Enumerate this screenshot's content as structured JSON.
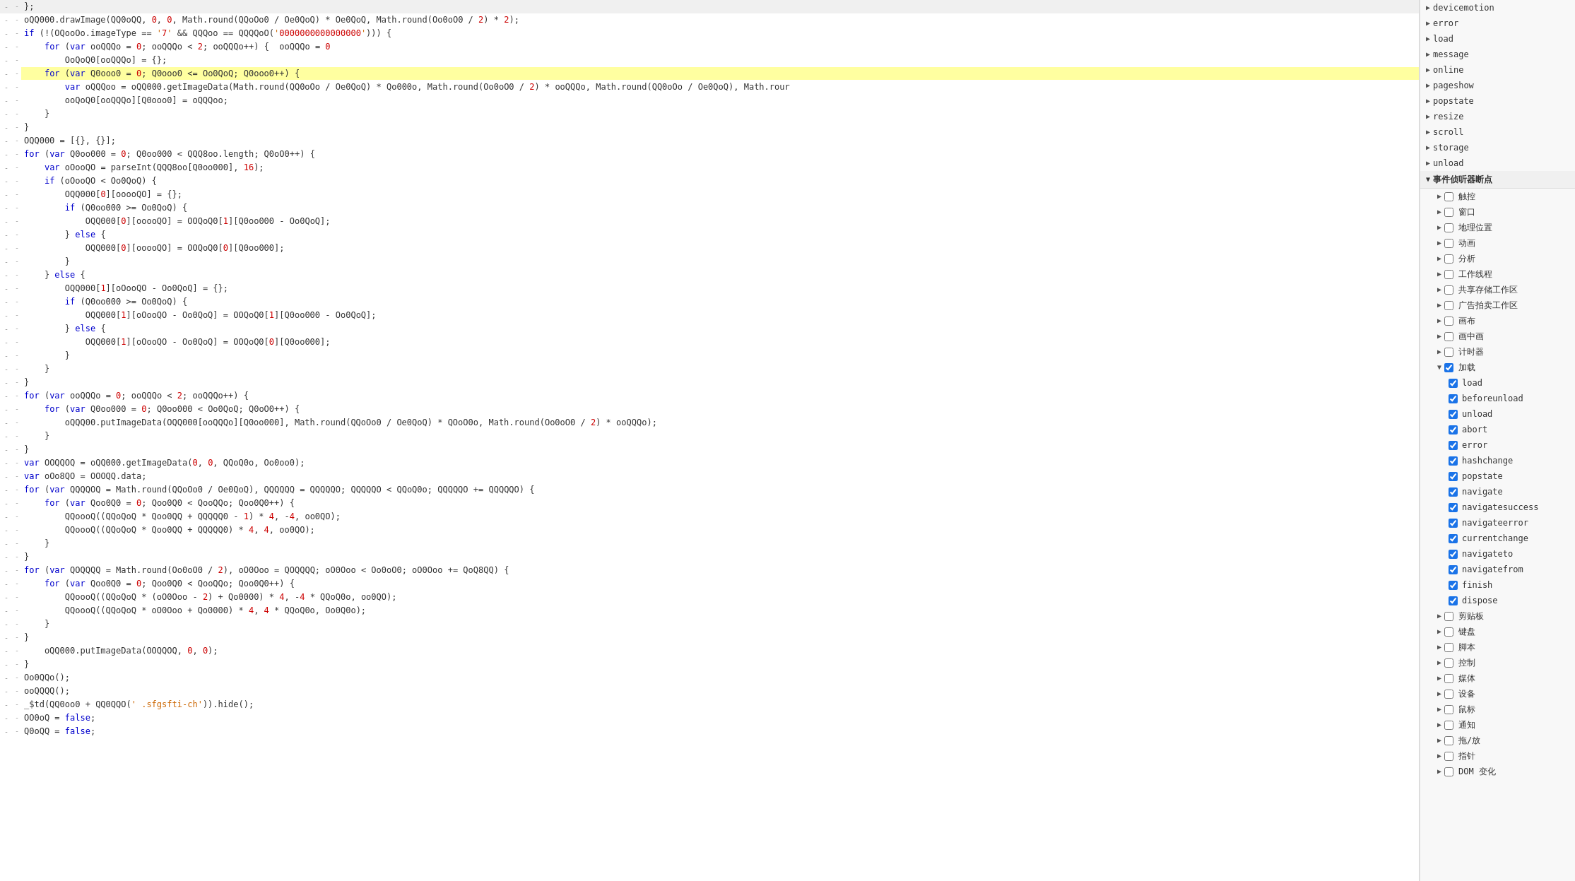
{
  "code_lines": [
    {
      "gutter": "-",
      "dash": "-",
      "content": "};",
      "highlight": false
    },
    {
      "gutter": "-",
      "dash": "-",
      "content": "oQQ000.drawImage(QQ0oQQ, 0, 0, Math.round(QQoOo0 / Oe0QoQ) * Oe0QoQ, Math.round(Oo0oO0 / 2) * 2);",
      "highlight": false
    },
    {
      "gutter": "-",
      "dash": "-",
      "content": "if (!(OQooOo.imageType == '7' && QQQoo == QQQQoO('0000000000000000'))) {",
      "highlight": false
    },
    {
      "gutter": "-",
      "dash": "-",
      "content": "    for (var ooQQQo = 0; ooQQQo < 2; ooQQQo++) {  ooQQQo = 0  ",
      "highlight": false,
      "has_badge": true
    },
    {
      "gutter": "-",
      "dash": "-",
      "content": "        OoQoQ0[ooQQQo] = {};",
      "highlight": false
    },
    {
      "gutter": "-",
      "dash": "-",
      "content": "    for (var Q0ooo0 = 0; Q0ooo0 <= Oo0QoQ; Q0ooo0++) {",
      "highlight": true
    },
    {
      "gutter": "-",
      "dash": "-",
      "content": "        var oQQQoo = oQQ000.getImageData(Math.round(QQ0oOo / Oe0QoQ) * Qo000o, Math.round(Oo0oO0 / 2) * ooQQQo, Math.round(QQ0oOo / Oe0QoQ), Math.rour",
      "highlight": false
    },
    {
      "gutter": "-",
      "dash": "-",
      "content": "        ooQoQ0[ooQQQo][Q0ooo0] = oQQQoo;",
      "highlight": false
    },
    {
      "gutter": "-",
      "dash": "-",
      "content": "    }",
      "highlight": false
    },
    {
      "gutter": "-",
      "dash": "-",
      "content": "}",
      "highlight": false
    },
    {
      "gutter": "-",
      "dash": "-",
      "content": "OQQ000 = [{}, {}];",
      "highlight": false
    },
    {
      "gutter": "-",
      "dash": "-",
      "content": "for (var Q0oo000 = 0; Q0oo000 < QQQ8oo.length; Q0oO0++) {",
      "highlight": false
    },
    {
      "gutter": "-",
      "dash": "-",
      "content": "    var oOooQO = parseInt(QQQ8oo[Q0oo000], 16);",
      "highlight": false
    },
    {
      "gutter": "-",
      "dash": "-",
      "content": "    if (oOooQO < Oo0QoQ) {",
      "highlight": false
    },
    {
      "gutter": "-",
      "dash": "-",
      "content": "        OQQ000[0][ooooQO] = {};",
      "highlight": false
    },
    {
      "gutter": "-",
      "dash": "-",
      "content": "        if (Q0oo000 >= Oo0QoQ) {",
      "highlight": false
    },
    {
      "gutter": "-",
      "dash": "-",
      "content": "            OQQ000[0][ooooQO] = OOQoQ0[1][Q0oo000 - Oo0QoQ];",
      "highlight": false
    },
    {
      "gutter": "-",
      "dash": "-",
      "content": "        } else {",
      "highlight": false
    },
    {
      "gutter": "-",
      "dash": "-",
      "content": "            OQQ000[0][ooooQO] = OOQoQ0[0][Q0oo000];",
      "highlight": false
    },
    {
      "gutter": "-",
      "dash": "-",
      "content": "        }",
      "highlight": false
    },
    {
      "gutter": "-",
      "dash": "-",
      "content": "    } else {",
      "highlight": false
    },
    {
      "gutter": "-",
      "dash": "-",
      "content": "        OQQ000[1][oOooQO - Oo0QoQ] = {};",
      "highlight": false
    },
    {
      "gutter": "-",
      "dash": "-",
      "content": "        if (Q0oo000 >= Oo0QoQ) {",
      "highlight": false
    },
    {
      "gutter": "-",
      "dash": "-",
      "content": "            OQQ000[1][oOooQO - Oo0QoQ] = OOQoQ0[1][Q0oo000 - Oo0QoQ];",
      "highlight": false
    },
    {
      "gutter": "-",
      "dash": "-",
      "content": "        } else {",
      "highlight": false
    },
    {
      "gutter": "-",
      "dash": "-",
      "content": "            OQQ000[1][oOooQO - Oo0QoQ] = OOQoQ0[0][Q0oo000];",
      "highlight": false
    },
    {
      "gutter": "-",
      "dash": "-",
      "content": "        }",
      "highlight": false
    },
    {
      "gutter": "-",
      "dash": "-",
      "content": "    }",
      "highlight": false
    },
    {
      "gutter": "-",
      "dash": "-",
      "content": "}",
      "highlight": false
    },
    {
      "gutter": "-",
      "dash": "-",
      "content": "for (var ooQQQo = 0; ooQQQo < 2; ooQQQo++) {",
      "highlight": false
    },
    {
      "gutter": "-",
      "dash": "-",
      "content": "    for (var Q0oo000 = 0; Q0oo000 < Oo0QoQ; Q0oO0++) {",
      "highlight": false
    },
    {
      "gutter": "-",
      "dash": "-",
      "content": "        oQQQ00.putImageData(OQQ000[ooQQQo][Q0oo000], Math.round(QQoOo0 / Oe0QoQ) * QOoO0o, Math.round(Oo0oO0 / 2) * ooQQQo);",
      "highlight": false
    },
    {
      "gutter": "-",
      "dash": "-",
      "content": "    }",
      "highlight": false
    },
    {
      "gutter": "-",
      "dash": "-",
      "content": "}",
      "highlight": false
    },
    {
      "gutter": "-",
      "dash": "-",
      "content": "var OOQQOQ = oQQ000.getImageData(0, 0, QQoQ0o, Oo0oo0);",
      "highlight": false
    },
    {
      "gutter": "-",
      "dash": "-",
      "content": "var oOo8QO = OOOQQ.data;",
      "highlight": false
    },
    {
      "gutter": "-",
      "dash": "-",
      "content": "for (var QQQQOQ = Math.round(QQoOo0 / Oe0QoQ), QQQQQQ = QQQQQO; QQQQQO < QQoQ0o; QQQQQO += QQQQQO) {",
      "highlight": false
    },
    {
      "gutter": "-",
      "dash": "-",
      "content": "    for (var Qoo0Q0 = 0; Qoo0Q0 < QooQQo; Qoo0Q0++) {",
      "highlight": false
    },
    {
      "gutter": "-",
      "dash": "-",
      "content": "        QQoooQ((QQoQoQ * Qoo0QQ + QQQQQ0 - 1) * 4, -4, oo0QO);",
      "highlight": false
    },
    {
      "gutter": "-",
      "dash": "-",
      "content": "        QQoooQ((QQoQoQ * Qoo0QQ + QQQQQ0) * 4, 4, oo0QO);",
      "highlight": false
    },
    {
      "gutter": "-",
      "dash": "-",
      "content": "    }",
      "highlight": false
    },
    {
      "gutter": "-",
      "dash": "-",
      "content": "}",
      "highlight": false
    },
    {
      "gutter": "-",
      "dash": "-",
      "content": "for (var QOQQQQ = Math.round(Oo0oO0 / 2), oO0Ooo = QOQQQQ; oO0Ooo < Oo0oO0; oO0Ooo += QoQ8QQ) {",
      "highlight": false
    },
    {
      "gutter": "-",
      "dash": "-",
      "content": "    for (var Qoo0Q0 = 0; Qoo0Q0 < QooQQo; Qoo0Q0++) {",
      "highlight": false
    },
    {
      "gutter": "-",
      "dash": "-",
      "content": "        QQoooQ((QQoQoQ * (oO0Ooo - 2) + Qo0000) * 4, -4 * QQoQ0o, oo0QO);",
      "highlight": false
    },
    {
      "gutter": "-",
      "dash": "-",
      "content": "        QQoooQ((QQoQoQ * oO0Ooo + Qo0000) * 4, 4 * QQoQ0o, Oo0Q0o);",
      "highlight": false
    },
    {
      "gutter": "-",
      "dash": "-",
      "content": "    }",
      "highlight": false
    },
    {
      "gutter": "-",
      "dash": "-",
      "content": "}",
      "highlight": false
    },
    {
      "gutter": "-",
      "dash": "-",
      "content": "    oQQ000.putImageData(OOQQOQ, 0, 0);",
      "highlight": false
    },
    {
      "gutter": "-",
      "dash": "-",
      "content": "}",
      "highlight": false
    },
    {
      "gutter": "-",
      "dash": "-",
      "content": "Oo0QQo();",
      "highlight": false
    },
    {
      "gutter": "-",
      "dash": "-",
      "content": "ooQQQQ();",
      "highlight": false
    },
    {
      "gutter": "-",
      "dash": "-",
      "content": "_$td(QQ0oo0 + QQ0QQO(' .sfgsfti-ch')).hide();",
      "highlight": false
    },
    {
      "gutter": "-",
      "dash": "-",
      "content": "OO0oQ = false;",
      "highlight": false
    },
    {
      "gutter": "-",
      "dash": "-",
      "content": "Q0oQQ = false;",
      "highlight": false
    }
  ],
  "right_panel": {
    "top_items": [
      {
        "label": "devicemotion",
        "type": "arrow"
      },
      {
        "label": "error",
        "type": "arrow"
      },
      {
        "label": "load",
        "type": "arrow"
      },
      {
        "label": "message",
        "type": "arrow"
      },
      {
        "label": "online",
        "type": "arrow"
      },
      {
        "label": "pageshow",
        "type": "arrow"
      },
      {
        "label": "popstate",
        "type": "arrow"
      },
      {
        "label": "resize",
        "type": "arrow"
      },
      {
        "label": "scroll",
        "type": "arrow"
      },
      {
        "label": "storage",
        "type": "arrow"
      },
      {
        "label": "unload",
        "type": "arrow"
      }
    ],
    "event_listener_section": {
      "title": "事件侦听器断点",
      "expanded": true
    },
    "event_groups": [
      {
        "label": "触控",
        "type": "arrow-check",
        "checked": false,
        "expanded": false
      },
      {
        "label": "窗口",
        "type": "arrow-check",
        "checked": false,
        "expanded": false
      },
      {
        "label": "地理位置",
        "type": "arrow-check",
        "checked": false,
        "expanded": false
      },
      {
        "label": "动画",
        "type": "arrow-check",
        "checked": false,
        "expanded": false
      },
      {
        "label": "分析",
        "type": "arrow-check",
        "checked": false,
        "expanded": false
      },
      {
        "label": "工作线程",
        "type": "arrow-check",
        "checked": false,
        "expanded": false
      },
      {
        "label": "共享存储工作区",
        "type": "arrow-check",
        "checked": false,
        "expanded": false
      },
      {
        "label": "广告拍卖工作区",
        "type": "arrow-check",
        "checked": false,
        "expanded": false
      },
      {
        "label": "画布",
        "type": "arrow-check",
        "checked": false,
        "expanded": false
      },
      {
        "label": "画中画",
        "type": "arrow-check",
        "checked": false,
        "expanded": false
      },
      {
        "label": "计时器",
        "type": "arrow-check",
        "checked": false,
        "expanded": false
      },
      {
        "label": "加载",
        "type": "arrow-check",
        "checked": true,
        "expanded": true
      }
    ],
    "load_sub_items": [
      {
        "label": "load",
        "checked": true
      },
      {
        "label": "beforeunload",
        "checked": true
      },
      {
        "label": "unload",
        "checked": true
      },
      {
        "label": "abort",
        "checked": true
      },
      {
        "label": "error",
        "checked": true
      },
      {
        "label": "hashchange",
        "checked": true
      },
      {
        "label": "popstate",
        "checked": true
      },
      {
        "label": "navigate",
        "checked": true
      },
      {
        "label": "navigatesuccess",
        "checked": true
      },
      {
        "label": "navigateerror",
        "checked": true
      },
      {
        "label": "currentchange",
        "checked": true
      },
      {
        "label": "navigateto",
        "checked": true
      },
      {
        "label": "navigatefrom",
        "checked": true
      },
      {
        "label": "finish",
        "checked": true
      },
      {
        "label": "dispose",
        "checked": true
      }
    ],
    "bottom_groups": [
      {
        "label": "剪贴板",
        "type": "arrow-check",
        "checked": false,
        "expanded": false
      },
      {
        "label": "键盘",
        "type": "arrow-check",
        "checked": false,
        "expanded": false
      },
      {
        "label": "脚本",
        "type": "arrow-check",
        "checked": false,
        "expanded": false
      },
      {
        "label": "控制",
        "type": "arrow-check",
        "checked": false,
        "expanded": false
      },
      {
        "label": "媒体",
        "type": "arrow-check",
        "checked": false,
        "expanded": false
      },
      {
        "label": "设备",
        "type": "arrow-check",
        "checked": false,
        "expanded": false
      },
      {
        "label": "鼠标",
        "type": "arrow-check",
        "checked": false,
        "expanded": false
      },
      {
        "label": "通知",
        "type": "arrow-check",
        "checked": false,
        "expanded": false
      },
      {
        "label": "拖/放",
        "type": "arrow-check",
        "checked": false,
        "expanded": false
      },
      {
        "label": "指针",
        "type": "arrow-check",
        "checked": false,
        "expanded": false
      },
      {
        "label": "DOM 变化",
        "type": "arrow-check",
        "checked": false,
        "expanded": false
      }
    ]
  },
  "colors": {
    "highlight_yellow": "#ffffa0",
    "highlight_blue_bg": "#add8e6",
    "keyword": "#0000cc",
    "number": "#cc0000",
    "accent": "#1a73e8"
  }
}
